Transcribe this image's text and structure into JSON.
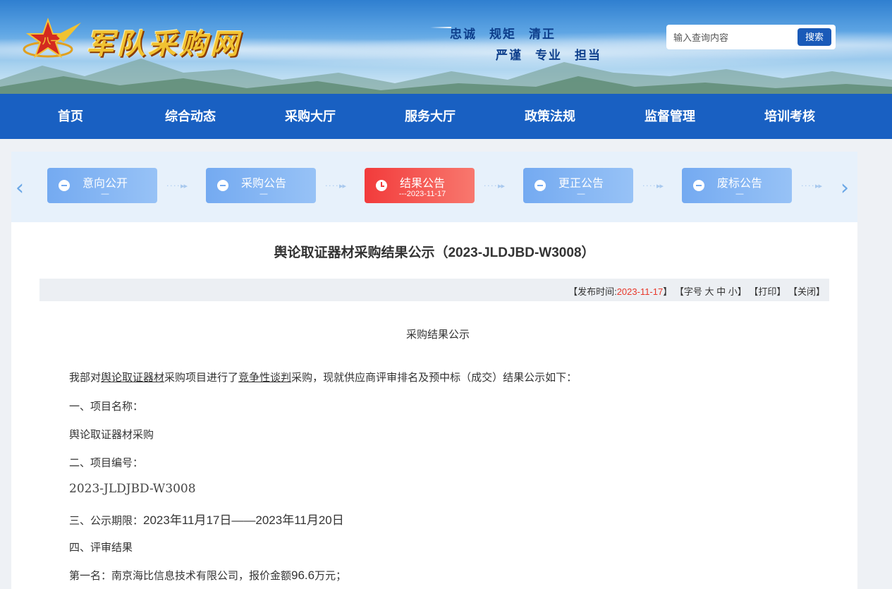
{
  "header": {
    "site_name": "军队采购网",
    "slogan_line1": [
      "忠诚",
      "规矩",
      "清正"
    ],
    "slogan_line2": [
      "严谨",
      "专业",
      "担当"
    ],
    "search": {
      "placeholder": "输入查询内容",
      "button": "搜索"
    }
  },
  "nav": {
    "items": [
      "首页",
      "综合动态",
      "采购大厅",
      "服务大厅",
      "政策法规",
      "监督管理",
      "培训考核"
    ]
  },
  "steps": [
    {
      "label": "意向公开",
      "sub": "—",
      "active": false
    },
    {
      "label": "采购公告",
      "sub": "—",
      "active": false
    },
    {
      "label": "结果公告",
      "sub": "---2023-11-17",
      "active": true
    },
    {
      "label": "更正公告",
      "sub": "—",
      "active": false
    },
    {
      "label": "废标公告",
      "sub": "—",
      "active": false
    }
  ],
  "article": {
    "title": "舆论取证器材采购结果公示（2023-JLDJBD-W3008）",
    "meta": {
      "publish_prefix": "【发布时间:",
      "publish_date": "2023-11-17",
      "publish_suffix": "】",
      "font_size": "【字号 大 中 小】",
      "print": "【打印】",
      "close": "【关闭】"
    },
    "subtitle": "采购结果公示",
    "intro_1": "我部对",
    "intro_link1": "舆论取证器材",
    "intro_2": "采购项目进行了",
    "intro_link2": "竞争性谈判",
    "intro_3": "采购，现就供应商评审排名及预中标（成交）结果公示如下：",
    "sec1_heading": "一、项目名称：",
    "sec1_value": "舆论取证器材采购",
    "sec2_heading": "二、项目编号：",
    "sec2_value": "2023-JLDJBD-W3008",
    "sec3_heading": "三、公示期限：",
    "sec3_value": "2023年11月17日——2023年11月20日",
    "sec4_heading": "四、评审结果",
    "rank1_prefix": "第一名：南京海比信息技术有限公司，报价金额",
    "rank1_amount": "96.6",
    "rank1_suffix": "万元；"
  },
  "colors": {
    "nav": "#1960c2",
    "active_step": "#f23b3b",
    "step": "#74aaf1",
    "date": "#e8382b"
  }
}
